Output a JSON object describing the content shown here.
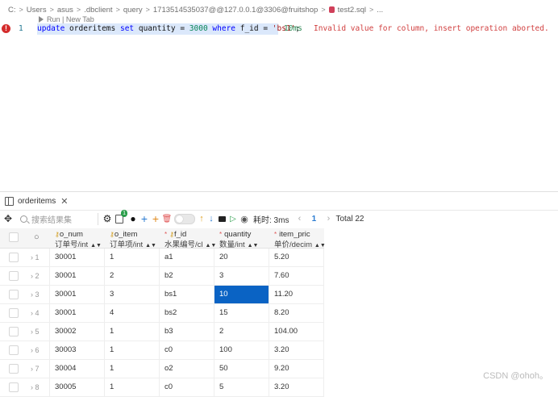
{
  "breadcrumb": {
    "parts": [
      "C:",
      "Users",
      "asus",
      ".dbclient",
      "query",
      "1713514535037@@127.0.0.1@3306@fruitshop",
      "test2.sql",
      "..."
    ]
  },
  "codelens": "Run | New Tab",
  "editor": {
    "line_number": "1",
    "tokens": {
      "t1": "update",
      "t2": " orderitems ",
      "t3": "set",
      "t4": " quantity = ",
      "t5": "3000",
      "t6": " ",
      "t7": "where",
      "t8": " f_id = ",
      "t9": "'bs1'",
      "t10": ";"
    },
    "exec_time": "10ms",
    "error": "Invalid value for column, insert operation aborted."
  },
  "result_tab": {
    "label": "orderitems"
  },
  "toolbar": {
    "search_placeholder": "搜索结果集",
    "badge_count": "1",
    "elapsed": "耗时: 3ms",
    "page": "1",
    "total": "Total 22"
  },
  "columns": [
    {
      "name": "o_num",
      "type": "订单号/int",
      "pk": true,
      "required": false
    },
    {
      "name": "o_item",
      "type": "订单项/int",
      "pk": true,
      "required": false
    },
    {
      "name": "f_id",
      "type": "水果编号/cl",
      "pk": true,
      "required": true
    },
    {
      "name": "quantity",
      "type": "数量/int",
      "pk": false,
      "required": true
    },
    {
      "name": "item_pric",
      "type": "单价/decim",
      "pk": false,
      "required": true
    }
  ],
  "rows": [
    {
      "idx": "1",
      "cells": [
        "30001",
        "1",
        "a1",
        "20",
        "5.20"
      ]
    },
    {
      "idx": "2",
      "cells": [
        "30001",
        "2",
        "b2",
        "3",
        "7.60"
      ]
    },
    {
      "idx": "3",
      "cells": [
        "30001",
        "3",
        "bs1",
        "10",
        "11.20"
      ]
    },
    {
      "idx": "4",
      "cells": [
        "30001",
        "4",
        "bs2",
        "15",
        "8.20"
      ]
    },
    {
      "idx": "5",
      "cells": [
        "30002",
        "1",
        "b3",
        "2",
        "104.00"
      ]
    },
    {
      "idx": "6",
      "cells": [
        "30003",
        "1",
        "c0",
        "100",
        "3.20"
      ]
    },
    {
      "idx": "7",
      "cells": [
        "30004",
        "1",
        "o2",
        "50",
        "9.20"
      ]
    },
    {
      "idx": "8",
      "cells": [
        "30005",
        "1",
        "c0",
        "5",
        "3.20"
      ]
    }
  ],
  "selected_cell": {
    "row": 2,
    "col": 3
  },
  "watermark": "CSDN @ohoh。",
  "colors": {
    "selection": "#0a63c4",
    "error": "#d42c2c",
    "keyword": "#0000ff"
  }
}
